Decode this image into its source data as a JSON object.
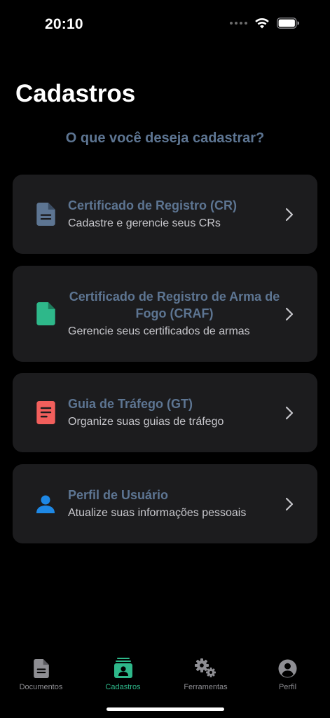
{
  "status": {
    "time": "20:10"
  },
  "page": {
    "title": "Cadastros",
    "subtitle": "O que você deseja cadastrar?"
  },
  "cards": [
    {
      "title": "Certificado de Registro (CR)",
      "description": "Cadastre e gerencie seus CRs",
      "icon": "document-icon",
      "color": "#5d7592"
    },
    {
      "title": "Certificado de Registro de Arma de Fogo (CRAF)",
      "description": "Gerencie seus certificados de armas",
      "icon": "file-icon",
      "color": "#2eb88a"
    },
    {
      "title": "Guia de Tráfego (GT)",
      "description": "Organize suas guias de tráfego",
      "icon": "list-document-icon",
      "color": "#f25f5c"
    },
    {
      "title": "Perfil de Usuário",
      "description": "Atualize suas informações pessoais",
      "icon": "user-icon",
      "color": "#1e88e5"
    }
  ],
  "tabs": [
    {
      "label": "Documentos",
      "icon": "document-icon",
      "active": false
    },
    {
      "label": "Cadastros",
      "icon": "contacts-stack-icon",
      "active": true
    },
    {
      "label": "Ferramentas",
      "icon": "gears-icon",
      "active": false
    },
    {
      "label": "Perfil",
      "icon": "user-circle-icon",
      "active": false
    }
  ],
  "colors": {
    "background": "#000000",
    "card": "#1c1c1e",
    "accent": "#2eb88a",
    "title_text": "#5d7592",
    "inactive_tab": "#8e8e93"
  }
}
